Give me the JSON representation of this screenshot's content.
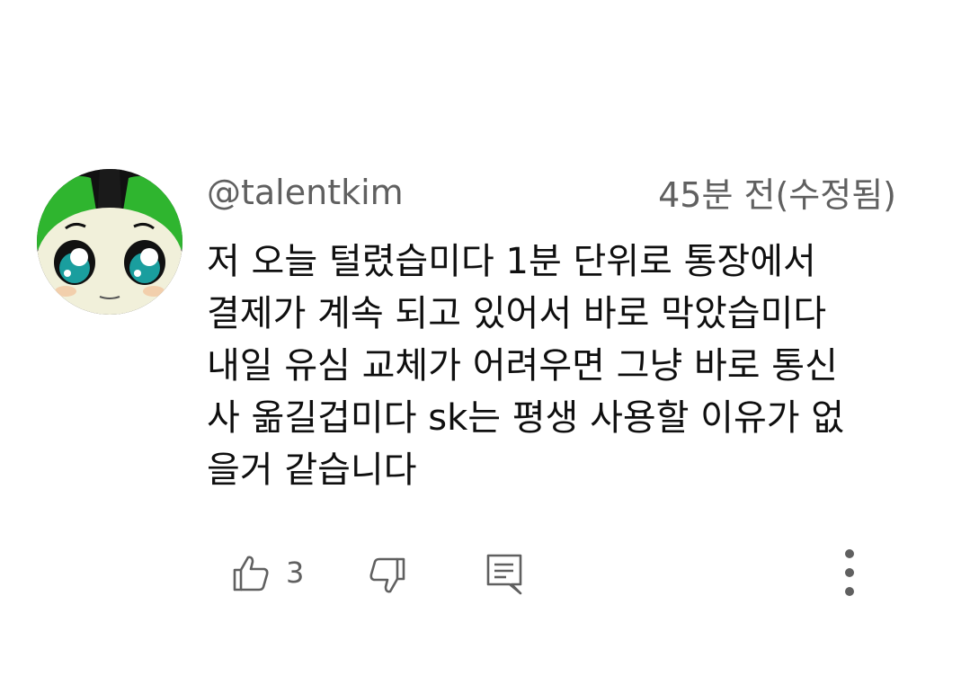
{
  "comment": {
    "avatar_icon": "avatar-cartoon-face",
    "username": "@talentkim",
    "timestamp": "45분 전(수정됨)",
    "text": "저 오늘 털렸습미다 1분 단위로 통장에서\n결제가 계속 되고 있어서 바로 막았습미다\n내일 유심 교체가 어려우면 그냥 바로 통신\n사 옮길겁미다 sk는 평생 사용할 이유가 없\n을거 같습니다",
    "like_count": "3"
  },
  "actions": {
    "like_icon": "thumbs-up-icon",
    "dislike_icon": "thumbs-down-icon",
    "reply_icon": "reply-icon",
    "more_icon": "more-vertical-icon"
  },
  "colors": {
    "text_primary": "#0f0f0f",
    "text_secondary": "#606060",
    "avatar_green": "#2fb52f"
  }
}
